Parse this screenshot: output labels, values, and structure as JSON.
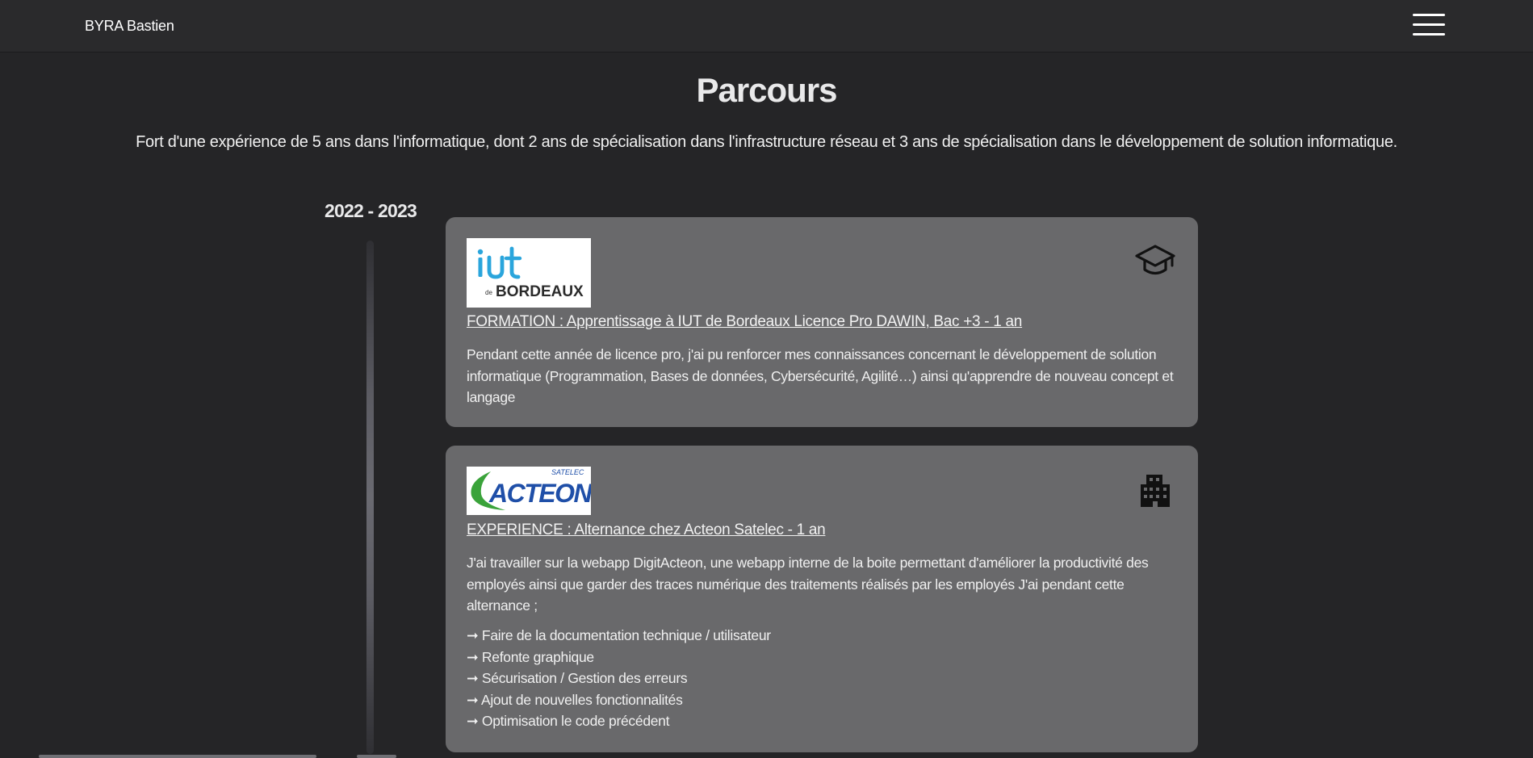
{
  "header": {
    "brand": "BYRA Bastien",
    "menu_icon": "hamburger-menu-icon"
  },
  "page": {
    "title": "Parcours",
    "intro": "Fort d'une expérience de 5 ans dans l'informatique, dont 2 ans de spécialisation dans l'infrastructure réseau et 3 ans de spécialisation dans le développement de solution informatique."
  },
  "timeline": {
    "year": "2022 - 2023",
    "entries": [
      {
        "logo": {
          "main": "iut",
          "prefix": "de",
          "sub": "BORDEAUX"
        },
        "icon": "graduation-cap-icon",
        "title": "FORMATION : Apprentissage à IUT de Bordeaux Licence Pro DAWIN, Bac +3 - 1 an",
        "description": "Pendant cette année de licence pro, j'ai pu renforcer mes connaissances concernant le développement de solution informatique (Programmation, Bases de données, Cybersécurité, Agilité…) ainsi qu'apprendre de nouveau concept et langage"
      },
      {
        "logo": {
          "main": "ACTEON",
          "sub": "SATELEC"
        },
        "icon": "office-building-icon",
        "title": "EXPERIENCE : Alternance chez Acteon Satelec - 1 an",
        "description": "J'ai travailler sur la webapp DigitActeon, une webapp interne de la boite permettant d'améliorer la productivité des employés ainsi que garder des traces numérique des traitements réalisés par les employés J'ai pendant cette alternance ;",
        "bullets": [
          "➞ Faire de la documentation technique / utilisateur",
          "➞ Refonte graphique",
          "➞ Sécurisation / Gestion des erreurs",
          "➞ Ajout de nouvelles fonctionnalités",
          "➞ Optimisation le code précédent"
        ]
      }
    ]
  },
  "colors": {
    "background": "#252527",
    "card": "#69696b",
    "iut_blue": "#2aa5dc",
    "acteon_blue": "#1f4fa8",
    "acteon_green": "#3aa33a"
  }
}
